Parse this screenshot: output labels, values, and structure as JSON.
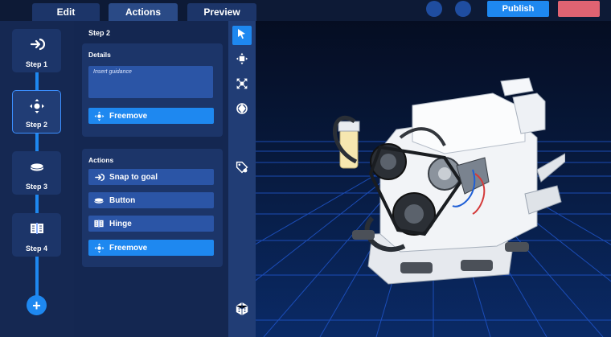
{
  "tabs": [
    {
      "label": "Edit"
    },
    {
      "label": "Actions"
    },
    {
      "label": "Preview"
    }
  ],
  "header": {
    "publish_label": "Publish"
  },
  "steps": [
    {
      "label": "Step 1",
      "icon": "snap-arrow-icon"
    },
    {
      "label": "Step 2",
      "icon": "move-arrows-icon"
    },
    {
      "label": "Step 3",
      "icon": "button-disc-icon"
    },
    {
      "label": "Step 4",
      "icon": "hinge-book-icon"
    }
  ],
  "add_step_label": "+",
  "editor": {
    "title": "Step 2",
    "details": {
      "title": "Details",
      "guidance_placeholder": "Insert guidance",
      "button_label": "Freemove"
    },
    "actions": {
      "title": "Actions",
      "items": [
        {
          "label": "Snap to goal",
          "icon": "snap-arrow-icon"
        },
        {
          "label": "Button",
          "icon": "button-disc-icon"
        },
        {
          "label": "Hinge",
          "icon": "hinge-book-icon"
        },
        {
          "label": "Freemove",
          "icon": "move-arrows-icon"
        }
      ]
    }
  },
  "tools": [
    "cursor-icon",
    "move-icon",
    "scale-icon",
    "rotate-icon",
    "tag-icon",
    "cube-icon"
  ],
  "colors": {
    "accent": "#1e88f0",
    "background": "#0f1d3c",
    "panel": "#1c3569",
    "danger": "#e06372"
  }
}
